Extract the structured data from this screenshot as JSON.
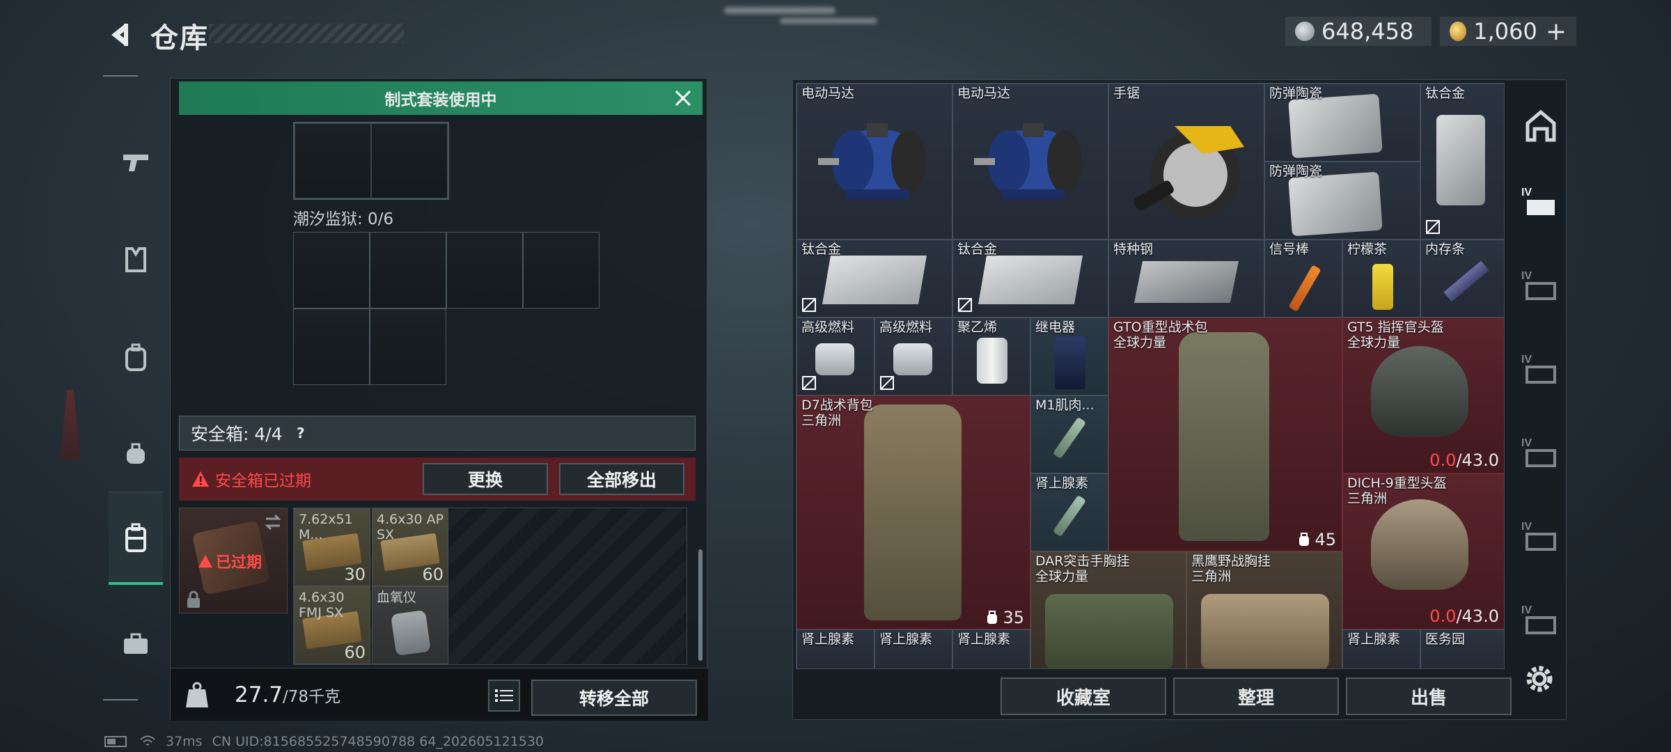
{
  "header": {
    "title": "仓库"
  },
  "currency": {
    "silver": "648,458",
    "gold": "1,060",
    "add_symbol": "+"
  },
  "left_nav": [
    "gun-icon",
    "armor-icon",
    "backpack-icon",
    "bag-icon",
    "safe-case-icon",
    "briefcase-icon"
  ],
  "loadout": {
    "banner": "制式套装使用中",
    "prison_label": "潮汐监狱: 0/6",
    "safe_box_label": "安全箱: 4/4",
    "help": "?",
    "expired_notice": "安全箱已过期",
    "replace_button": "更换",
    "move_all_button": "全部移出",
    "case_status": "已过期",
    "safe_items": [
      {
        "name": "7.62x51 M...",
        "count": "30"
      },
      {
        "name": "4.6x30 AP SX",
        "count": "60"
      },
      {
        "name": "4.6x30 FMJ SX",
        "count": "60"
      },
      {
        "name": "血氧仪",
        "count": ""
      }
    ],
    "weight": "27.7",
    "weight_max": "/78千克",
    "transfer_all_button": "转移全部"
  },
  "inventory": {
    "items": [
      {
        "name": "电动马达"
      },
      {
        "name": "电动马达"
      },
      {
        "name": "手锯"
      },
      {
        "name": "防弹陶瓷"
      },
      {
        "name": "防弹陶瓷"
      },
      {
        "name": "钛合金"
      },
      {
        "name": "钛合金"
      },
      {
        "name": "钛合金"
      },
      {
        "name": "特种钢"
      },
      {
        "name": "信号棒"
      },
      {
        "name": "柠檬茶"
      },
      {
        "name": "内存条"
      },
      {
        "name": "高级燃料"
      },
      {
        "name": "高级燃料"
      },
      {
        "name": "聚乙烯"
      },
      {
        "name": "继电器"
      },
      {
        "name": "GTO重型战术包",
        "sub": "全球力量",
        "qty": "45"
      },
      {
        "name": "GT5 指挥官头盔",
        "sub": "全球力量",
        "dura_cur": "0.0",
        "dura_max": "/43.0"
      },
      {
        "name": "D7战术背包",
        "sub": "三角洲",
        "qty": "35"
      },
      {
        "name": "M1肌肉..."
      },
      {
        "name": "肾上腺素"
      },
      {
        "name": "DICH-9重型头盔",
        "sub": "三角洲",
        "dura_cur": "0.0",
        "dura_max": "/43.0"
      },
      {
        "name": "DAR突击手胸挂",
        "sub": "全球力量"
      },
      {
        "name": "黑鹰野战胸挂",
        "sub": "三角洲"
      },
      {
        "name": "肾上腺素"
      },
      {
        "name": "肾上腺素"
      },
      {
        "name": "肾上腺素"
      },
      {
        "name": "肾上腺素"
      },
      {
        "name": "医务园"
      }
    ],
    "buttons": {
      "collection": "收藏室",
      "sort": "整理",
      "sell": "出售"
    }
  },
  "right_rail": [
    "safe-house-icon",
    "IV",
    "IV",
    "IV",
    "IV",
    "IV",
    "IV",
    "settings-icon"
  ],
  "status": {
    "ping": "37ms",
    "uid": "CN UID:815685525748590788 64_202605121530"
  },
  "colors": {
    "accent_green": "#2c9066",
    "danger_red": "#ff4a4a"
  }
}
